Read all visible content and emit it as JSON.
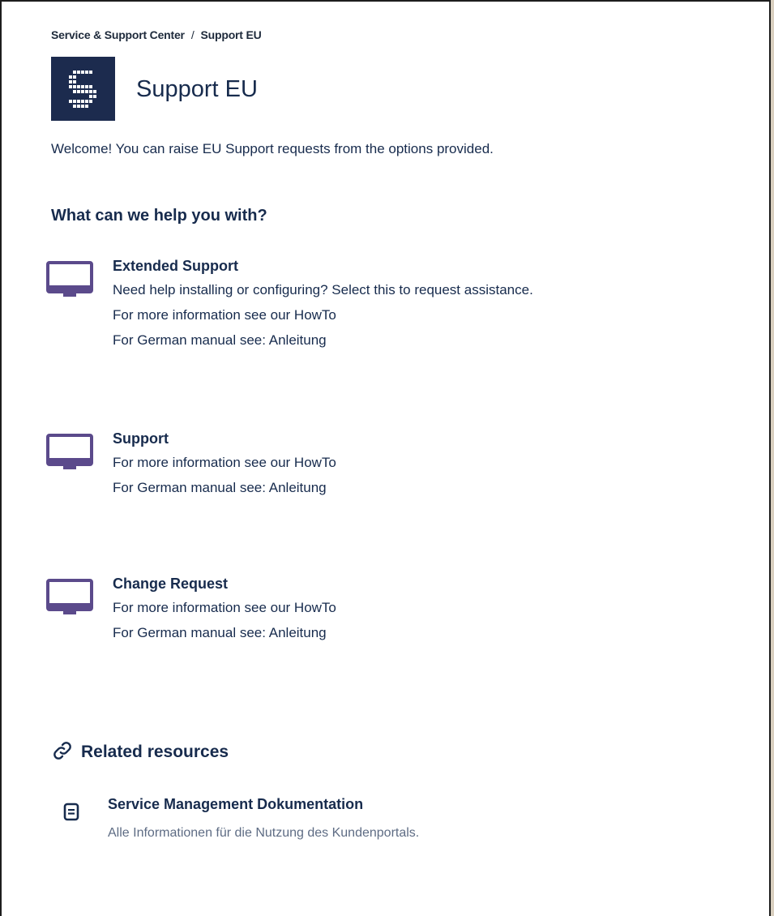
{
  "breadcrumb": {
    "root": "Service & Support Center",
    "separator": "/",
    "current": "Support EU"
  },
  "header": {
    "title": "Support EU",
    "logo_color": "#1c2b4e"
  },
  "welcome_text": "Welcome! You can raise EU Support requests from the options provided.",
  "help_heading": "What can we help you with?",
  "options": [
    {
      "icon": "monitor-icon",
      "title": "Extended Support",
      "lines": [
        "Need help installing or configuring? Select this to request assistance.",
        "For more information see our HowTo",
        "For German manual see: Anleitung"
      ]
    },
    {
      "icon": "monitor-icon",
      "title": "Support",
      "lines": [
        "For more information see our HowTo",
        "For German manual see: Anleitung"
      ]
    },
    {
      "icon": "monitor-icon",
      "title": "Change Request",
      "lines": [
        "For more information see our HowTo",
        "For German manual see: Anleitung"
      ]
    }
  ],
  "related": {
    "heading": "Related resources",
    "icon": "link-icon",
    "items": [
      {
        "icon": "document-icon",
        "title": "Service Management Dokumentation",
        "description": "Alle Informationen für die Nutzung des Kundenportals."
      }
    ]
  },
  "colors": {
    "icon_purple": "#5b4a8b",
    "text_dark": "#172b4d",
    "text_subtle": "#5e6c84"
  }
}
